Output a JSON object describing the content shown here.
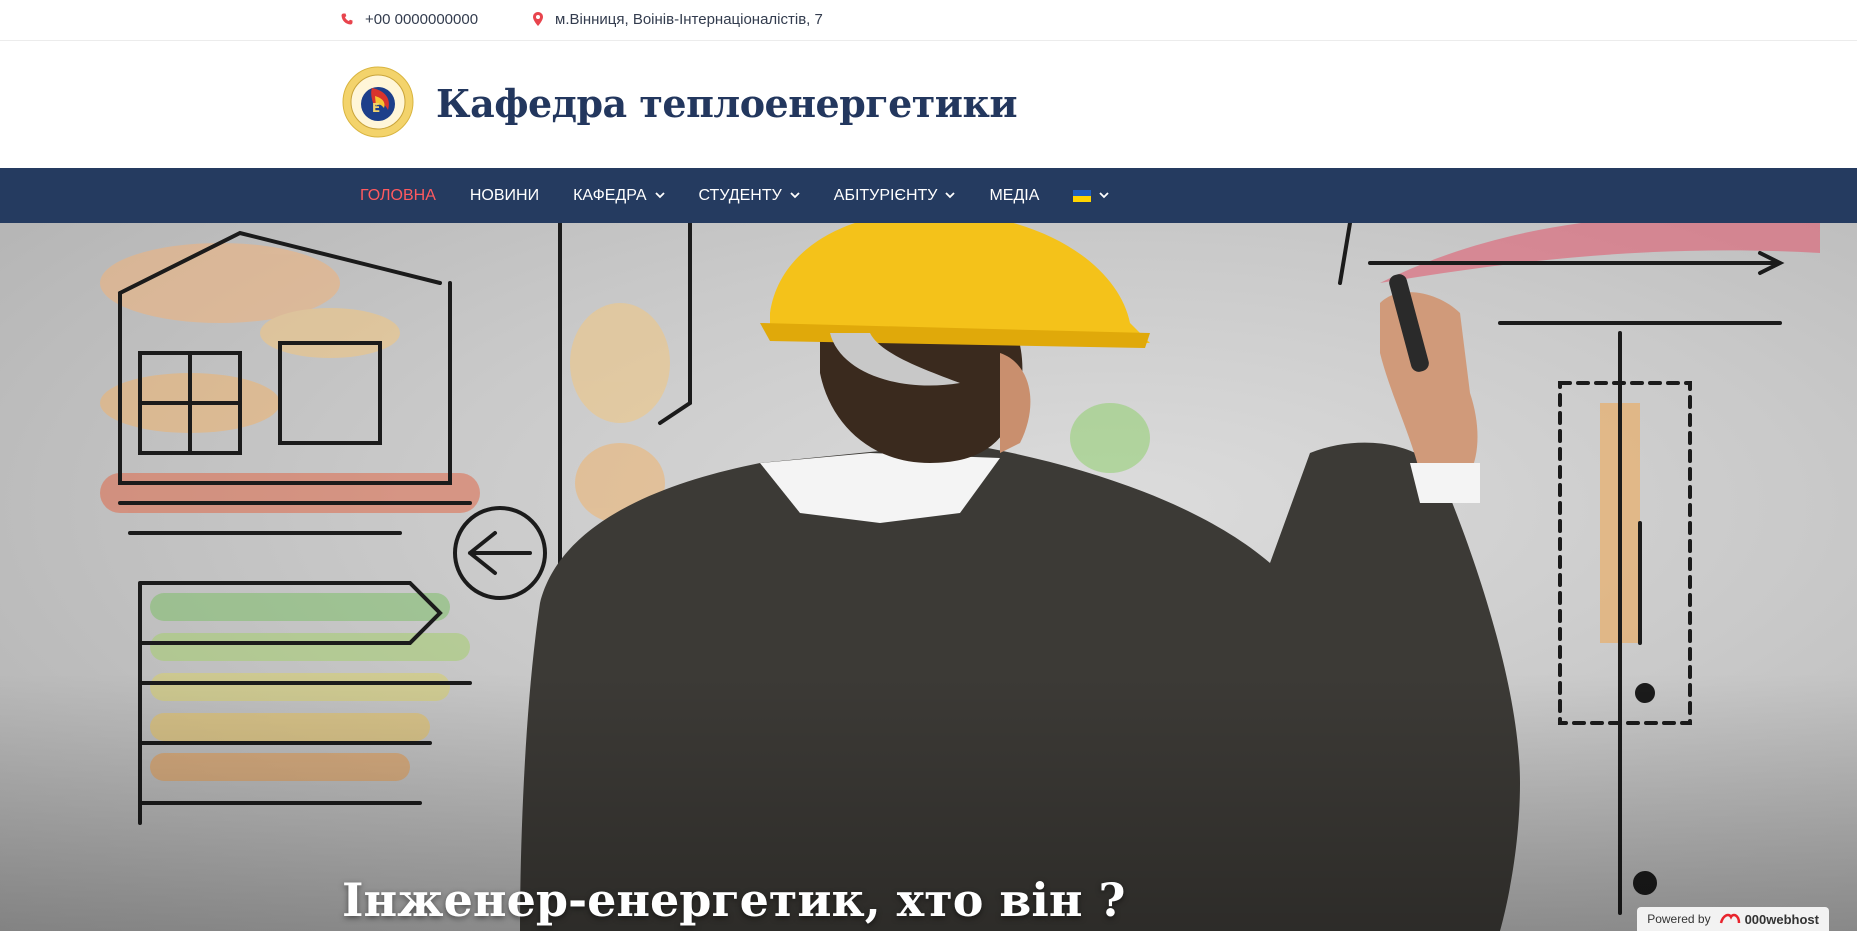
{
  "topbar": {
    "phone": "+00 0000000000",
    "address": "м.Вінниця, Воінів-Інтернаціоналістів, 7",
    "phone_icon": "phone-icon",
    "address_icon": "map-marker-icon"
  },
  "header": {
    "site_title": "Кафедра теплоенергетики",
    "logo_icon": "department-logo"
  },
  "nav": {
    "items": [
      {
        "label": "ГОЛОВНА",
        "active": true,
        "dropdown": false
      },
      {
        "label": "НОВИНИ",
        "active": false,
        "dropdown": false
      },
      {
        "label": "КАФЕДРА",
        "active": false,
        "dropdown": true
      },
      {
        "label": "СТУДЕНТУ",
        "active": false,
        "dropdown": true
      },
      {
        "label": "АБІТУРІЄНТУ",
        "active": false,
        "dropdown": true
      },
      {
        "label": "МЕДІА",
        "active": false,
        "dropdown": false
      }
    ],
    "language_icon": "ukraine-flag-icon"
  },
  "hero": {
    "title": "Інженер-енергетик, хто він ?"
  },
  "footer_badge": {
    "powered_by": "Powered by",
    "brand": "000webhost"
  },
  "colors": {
    "nav_bg": "#253b60",
    "active": "#ff5a5f",
    "title": "#23375e",
    "icon_accent": "#e8444d"
  }
}
